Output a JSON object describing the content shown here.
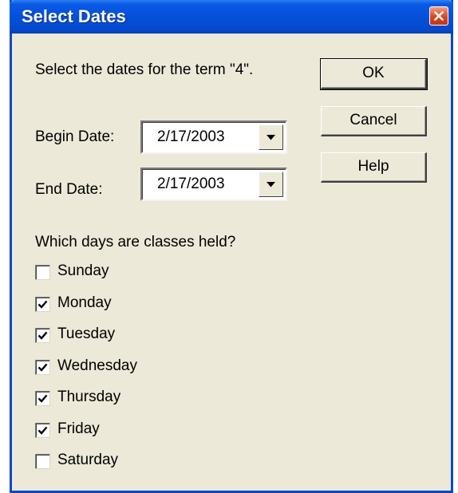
{
  "window": {
    "title": "Select Dates"
  },
  "prompt": "Select the dates for the term \"4\".",
  "buttons": {
    "ok": "OK",
    "cancel": "Cancel",
    "help": "Help"
  },
  "begin": {
    "label": "Begin Date:",
    "value": "2/17/2003"
  },
  "end": {
    "label": "End Date:",
    "value": "2/17/2003"
  },
  "days_question": "Which days are classes held?",
  "days": [
    {
      "label": "Sunday",
      "checked": false
    },
    {
      "label": "Monday",
      "checked": true
    },
    {
      "label": "Tuesday",
      "checked": true
    },
    {
      "label": "Wednesday",
      "checked": true
    },
    {
      "label": "Thursday",
      "checked": true
    },
    {
      "label": "Friday",
      "checked": true
    },
    {
      "label": "Saturday",
      "checked": false
    }
  ],
  "icons": {
    "close": "close-icon",
    "dropdown": "dropdown-arrow-icon",
    "check": "check-icon"
  },
  "colors": {
    "titlebar": "#0550d8",
    "dialog_bg": "#ece9d8",
    "close_button": "#d8461f"
  }
}
